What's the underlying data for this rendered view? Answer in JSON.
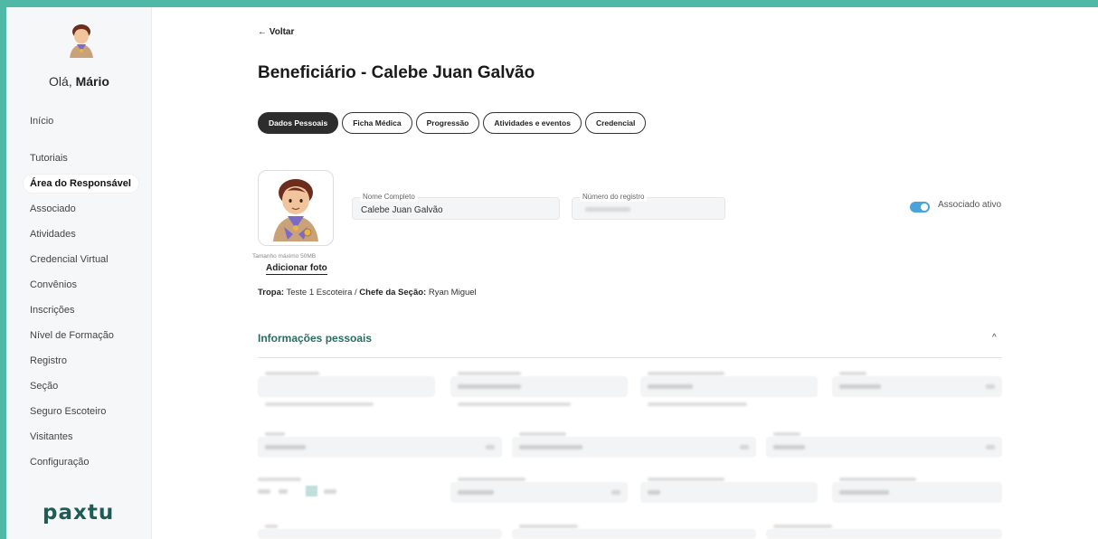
{
  "sidebar": {
    "greeting_prefix": "Olá,",
    "user_name": "Mário",
    "items": [
      {
        "label": "Início"
      },
      {
        "label": "Tutoriais"
      },
      {
        "label": "Área do Responsável"
      },
      {
        "label": "Associado"
      },
      {
        "label": "Atividades"
      },
      {
        "label": "Credencial Virtual"
      },
      {
        "label": "Convênios"
      },
      {
        "label": "Inscrições"
      },
      {
        "label": "Nível de Formação"
      },
      {
        "label": "Registro"
      },
      {
        "label": "Seção"
      },
      {
        "label": "Seguro Escoteiro"
      },
      {
        "label": "Visitantes"
      },
      {
        "label": "Configuração"
      }
    ],
    "active_item": "Área do Responsável",
    "logo_text": "paxtu"
  },
  "header": {
    "back_label": "← Voltar",
    "title": "Beneficiário - Calebe Juan Galvão"
  },
  "tabs": [
    {
      "label": "Dados Pessoais",
      "active": true
    },
    {
      "label": "Ficha Médica",
      "active": false
    },
    {
      "label": "Progressão",
      "active": false
    },
    {
      "label": "Atividades e eventos",
      "active": false
    },
    {
      "label": "Credencial",
      "active": false
    }
  ],
  "profile": {
    "photo_max_size": "Tamanho máximo 50MB",
    "add_photo_label": "Adicionar foto",
    "full_name_label": "Nome Completo",
    "full_name_value": "Calebe Juan Galvão",
    "registry_label": "Número do registro",
    "active_label": "Associado ativo",
    "active": true,
    "tropa_label": "Tropa:",
    "tropa_value": "Teste 1 Escoteira /",
    "chefe_label": "Chefe da Seção:",
    "chefe_value": "Ryan Miguel"
  },
  "personal_info": {
    "title": "Informações pessoais",
    "chevron": "^"
  },
  "colors": {
    "accent": "#4fb8a7",
    "section_title": "#2a6b62",
    "toggle_on": "#4aa3d9",
    "logo": "#1e5c55"
  },
  "icons": {
    "back": "arrow-left-icon",
    "collapse": "chevron-up-icon"
  }
}
